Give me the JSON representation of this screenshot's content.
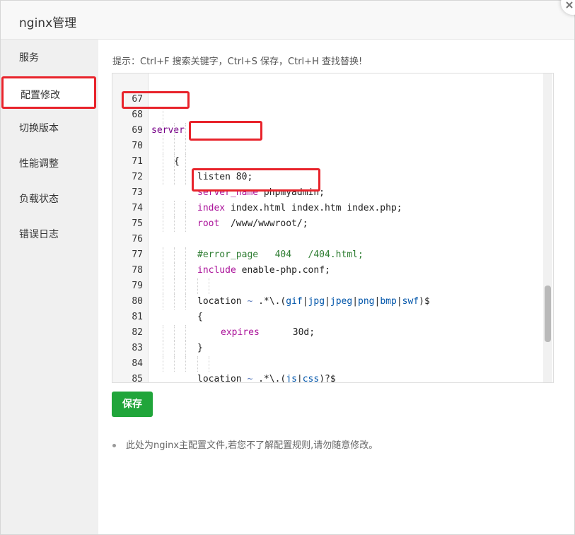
{
  "window": {
    "title": "nginx管理"
  },
  "sidebar": {
    "items": [
      {
        "label": "服务",
        "active": false
      },
      {
        "label": "配置修改",
        "active": true
      },
      {
        "label": "切换版本",
        "active": false
      },
      {
        "label": "性能调整",
        "active": false
      },
      {
        "label": "负载状态",
        "active": false
      },
      {
        "label": "错误日志",
        "active": false
      }
    ]
  },
  "main": {
    "hint": "提示：Ctrl+F 搜索关键字，Ctrl+S 保存，Ctrl+H 查找替换!",
    "editor": {
      "line_numbers": [
        "67",
        "68",
        "69",
        "70",
        "71",
        "72",
        "73",
        "74",
        "75",
        "76",
        "77",
        "78",
        "79",
        "80",
        "81",
        "82",
        "83",
        "84",
        "85"
      ]
    },
    "save_label": "保存",
    "note": "此处为nginx主配置文件,若您不了解配置规则,请勿随意修改。"
  },
  "colors": {
    "accent": "#20a53a",
    "highlight_box": "#e8232b",
    "keyword": "#770088"
  }
}
